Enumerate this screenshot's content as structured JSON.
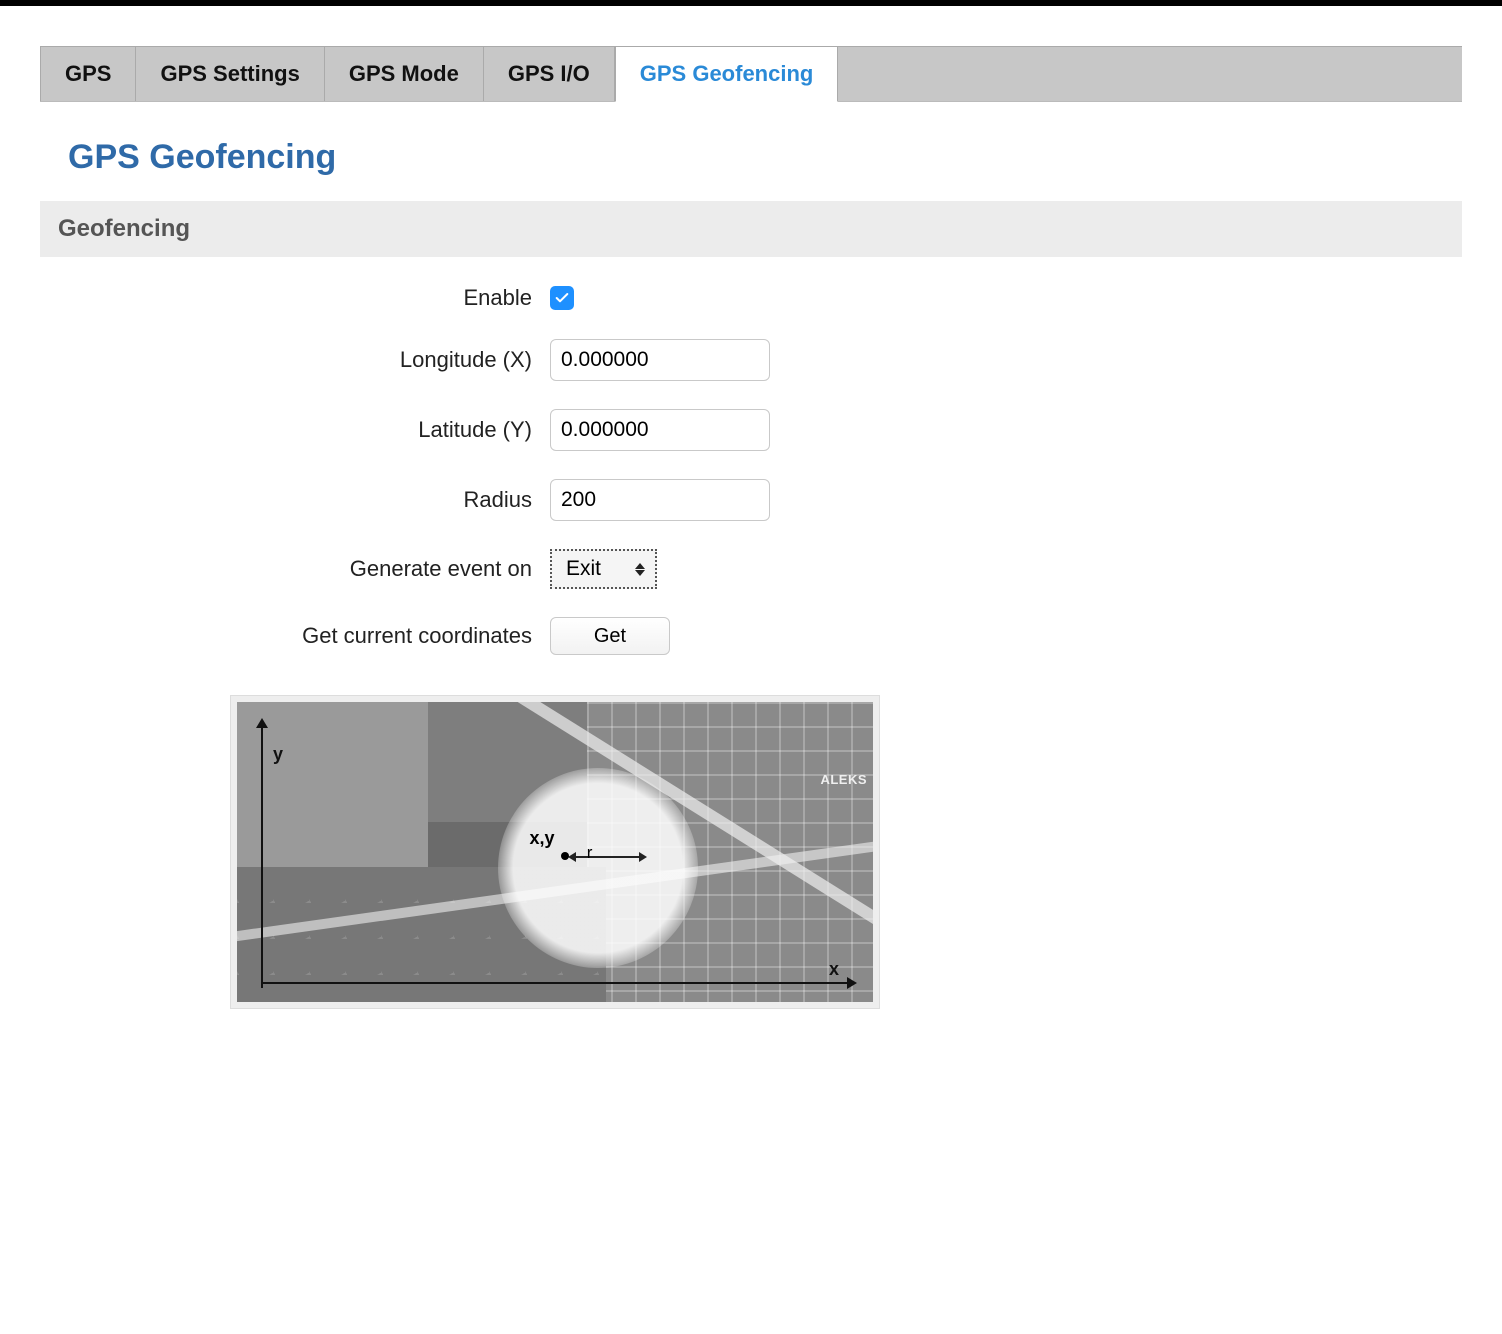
{
  "tabs": [
    {
      "label": "GPS",
      "active": false
    },
    {
      "label": "GPS Settings",
      "active": false
    },
    {
      "label": "GPS Mode",
      "active": false
    },
    {
      "label": "GPS I/O",
      "active": false
    },
    {
      "label": "GPS Geofencing",
      "active": true
    }
  ],
  "page_title": "GPS Geofencing",
  "section_title": "Geofencing",
  "form": {
    "enable": {
      "label": "Enable",
      "checked": true
    },
    "longitude": {
      "label": "Longitude (X)",
      "value": "0.000000"
    },
    "latitude": {
      "label": "Latitude (Y)",
      "value": "0.000000"
    },
    "radius": {
      "label": "Radius",
      "value": "200"
    },
    "event": {
      "label": "Generate event on",
      "value": "Exit"
    },
    "get": {
      "label": "Get current coordinates",
      "button": "Get"
    }
  },
  "map": {
    "y_axis_label": "y",
    "x_axis_label": "x",
    "center_label": "x,y",
    "radius_label": "r",
    "edge_label": "ALEKS"
  }
}
